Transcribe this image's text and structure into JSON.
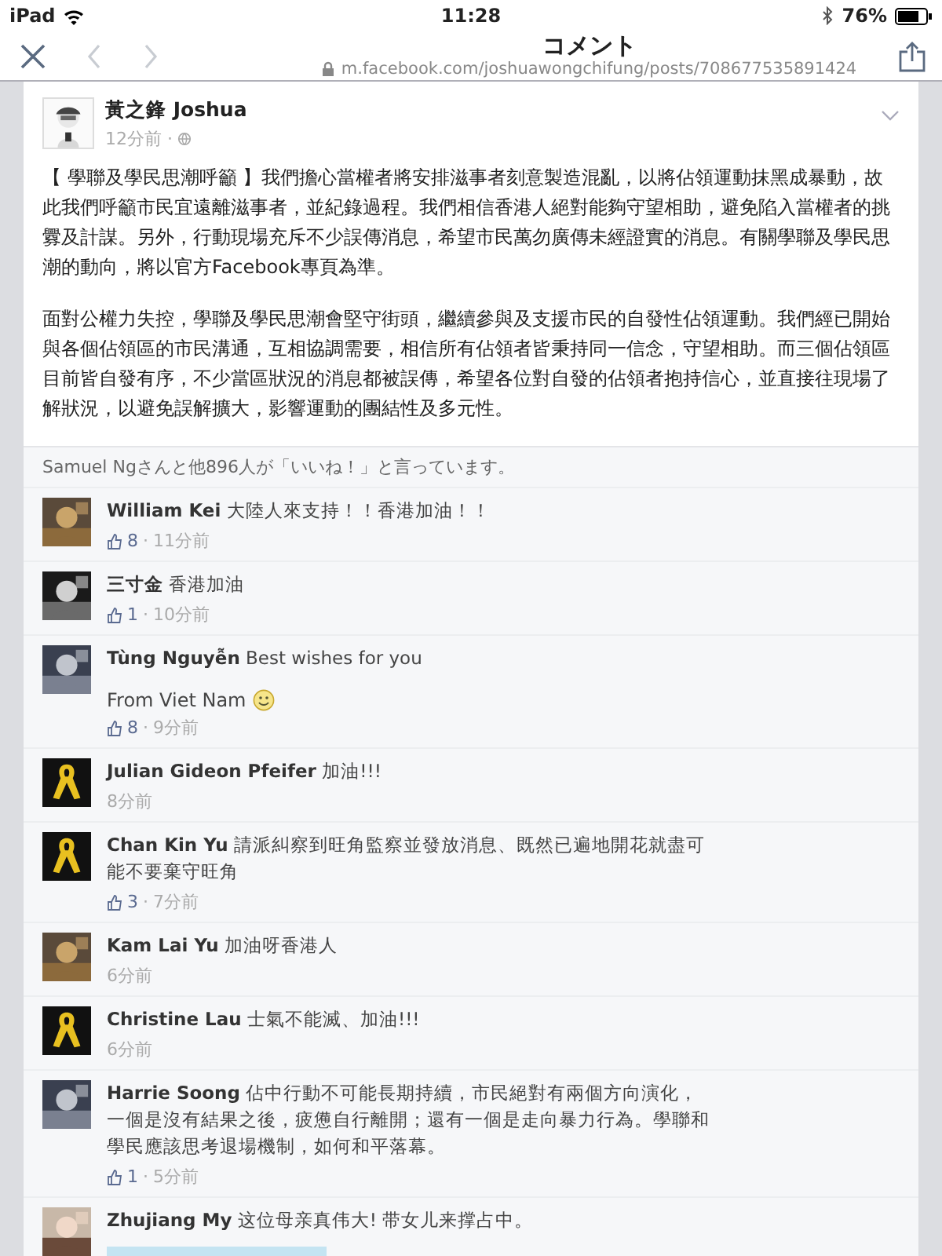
{
  "status_bar": {
    "device": "iPad",
    "time": "11:28",
    "battery": "76%"
  },
  "browser": {
    "title": "コメント",
    "url": "m.facebook.com/joshuawongchifung/posts/708677535891424",
    "back_disabled": true,
    "forward_disabled": true
  },
  "post": {
    "author": "黃之鋒 Joshua",
    "time": "12分前 ·",
    "paragraphs": [
      "【 學聯及學民思潮呼籲 】我們擔心當權者將安排滋事者刻意製造混亂，以將佔領運動抹黑成暴動，故此我們呼籲市民宜遠離滋事者，並紀錄過程。我們相信香港人絕對能夠守望相助，避免陷入當權者的挑釁及計謀。另外，行動現場充斥不少誤傳消息，希望市民萬勿廣傳未經證實的消息。有關學聯及學民思潮的動向，將以官方Facebook專頁為準。",
      "面對公權力失控，學聯及學民思潮會堅守街頭，繼續參與及支援市民的自發性佔領運動。我們經已開始與各個佔領區的市民溝通，互相協調需要，相信所有佔領者皆秉持同一信念，守望相助。而三個佔領區目前皆自發有序，不少當區狀況的消息都被誤傳，希望各位對自發的佔領者抱持信心，並直接往現場了解狀況，以避免誤解擴大，影響運動的團結性及多元性。"
    ]
  },
  "likes_summary": "Samuel Ngさんと他896人が「いいね！」と言っています。",
  "comments": [
    {
      "ribbon_avatar": false,
      "name": "William Kei",
      "text": "大陸人來支持！！香港加油！！",
      "likes": "8",
      "separator": "·",
      "time": "11分前"
    },
    {
      "ribbon_avatar": false,
      "name": "三寸金",
      "text": "香港加油",
      "likes": "1",
      "separator": "·",
      "time": "10分前"
    },
    {
      "ribbon_avatar": false,
      "name": "Tùng Nguyễn",
      "text": "Best wishes for you",
      "second_line": "From Viet Nam",
      "smiley": true,
      "likes": "8",
      "separator": "·",
      "time": "9分前"
    },
    {
      "ribbon_avatar": true,
      "name": "Julian Gideon Pfeifer",
      "text": "加油!!!",
      "time": "8分前"
    },
    {
      "ribbon_avatar": true,
      "name": "Chan Kin Yu",
      "text": "請派糾察到旺角監察並發放消息、既然已遍地開花就盡可能不要棄守旺角",
      "likes": "3",
      "separator": "·",
      "time": "7分前"
    },
    {
      "ribbon_avatar": false,
      "name": "Kam Lai Yu",
      "text": "加油呀香港人",
      "time": "6分前"
    },
    {
      "ribbon_avatar": true,
      "name": "Christine Lau",
      "text": "士氣不能滅、加油!!!",
      "time": "6分前"
    },
    {
      "ribbon_avatar": false,
      "name": "Harrie Soong",
      "text": "佔中行動不可能長期持續，市民絕對有兩個方向演化，一個是沒有結果之後，疲憊自行離開；還有一個是走向暴力行為。學聯和學民應該思考退場機制，如何和平落幕。",
      "likes": "1",
      "separator": "·",
      "time": "5分前"
    },
    {
      "ribbon_avatar": false,
      "name": "Zhujiang My",
      "text": "这位母亲真伟大! 带女儿来撑占中。",
      "image_attached": true
    }
  ]
}
